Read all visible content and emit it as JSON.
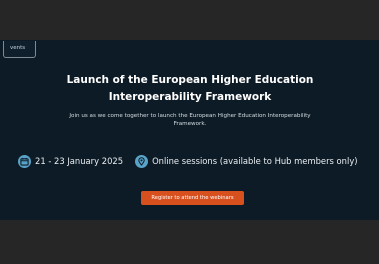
{
  "tab": {
    "label": "vents"
  },
  "banner": {
    "title_line1": "Launch of the European Higher Education",
    "title_line2": "Interoperability Framework",
    "subtitle_line1": "Join us as we come together to launch the European Higher Education Interoperability",
    "subtitle_line2": "Framework."
  },
  "info": {
    "dates": "21 - 23 January 2025",
    "dates_icon": "calendar-icon",
    "location": "Online sessions (available to Hub members only)",
    "location_icon": "map-pin-icon"
  },
  "cta": {
    "label": "Register to attend the webinars"
  },
  "colors": {
    "banner_bg": "#0d1b26",
    "accent_icon": "#5aa3c8",
    "cta_bg": "#d9501f"
  }
}
